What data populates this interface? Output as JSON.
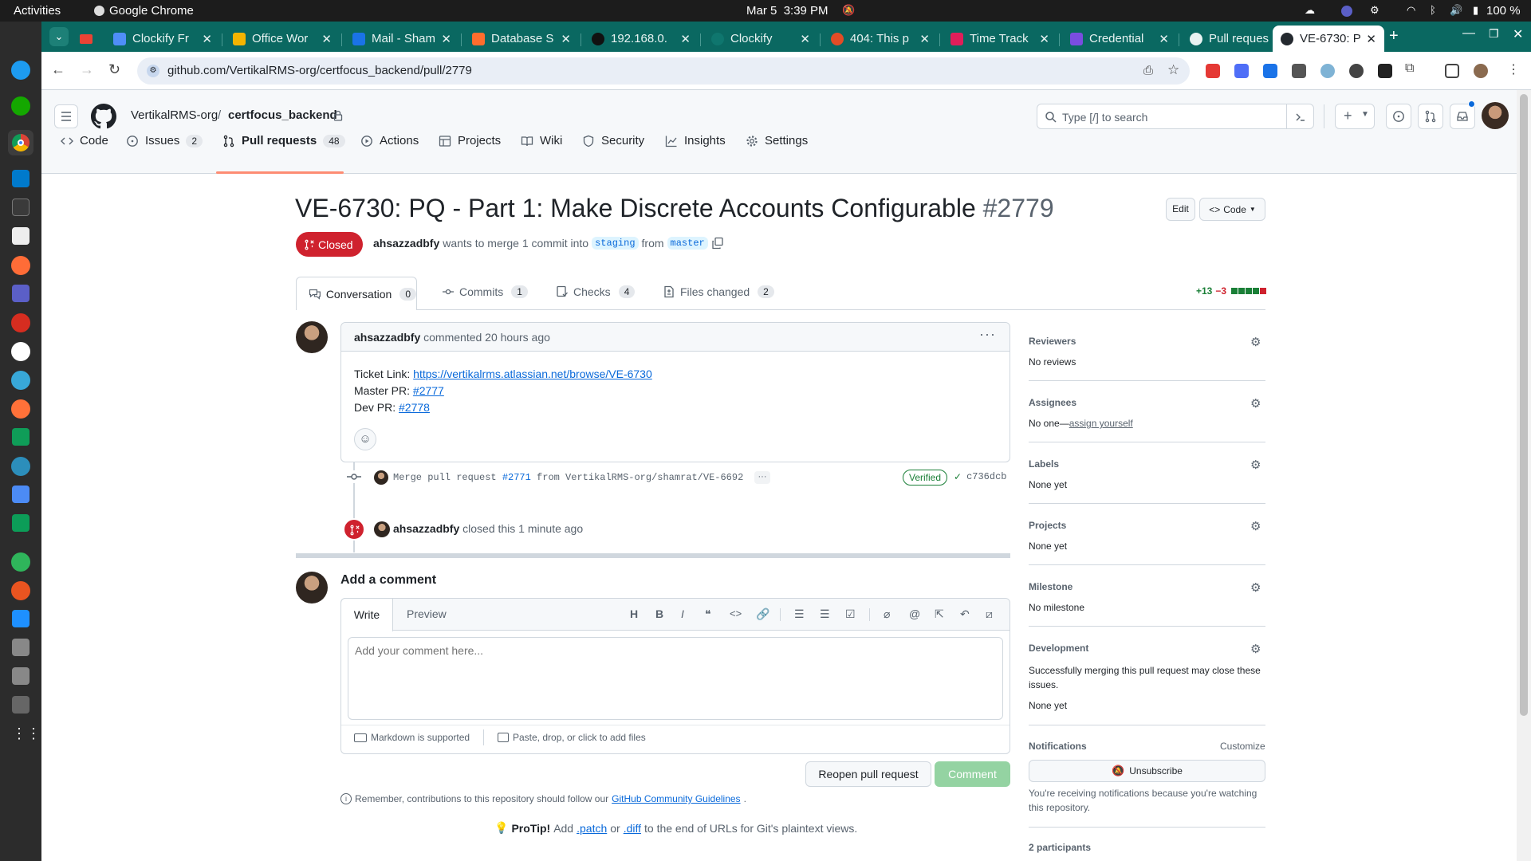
{
  "os": {
    "activities": "Activities",
    "app": "Google Chrome",
    "date": "Mar 5",
    "time": "3:39 PM",
    "battery": "100 %"
  },
  "tabs": [
    {
      "label": "Clockify Fr",
      "color": "#4f8ef7"
    },
    {
      "label": "Office Wor",
      "color": "#f4b400"
    },
    {
      "label": "Mail - Sham",
      "color": "#1a73e8"
    },
    {
      "label": "Database S",
      "color": "#ff6d2d"
    },
    {
      "label": "192.168.0.",
      "color": "#111111"
    },
    {
      "label": "Clockify",
      "color": "#0a6861"
    },
    {
      "label": "404: This p",
      "color": "#e34c26"
    },
    {
      "label": "Time Track",
      "color": "#e01e5a"
    },
    {
      "label": "Credential",
      "color": "#7a4de0"
    },
    {
      "label": "Pull reques",
      "color": "#24292f"
    },
    {
      "label": "VE-6730: P",
      "color": "#24292f"
    }
  ],
  "url": "github.com/VertikalRMS-org/certfocus_backend/pull/2779",
  "repo": {
    "owner": "VertikalRMS-org",
    "sep": "/",
    "name": "certfocus_backend",
    "search_placeholder": "Type [/] to search"
  },
  "nav": {
    "code": "Code",
    "issues": "Issues",
    "issues_count": "2",
    "prs": "Pull requests",
    "prs_count": "48",
    "actions": "Actions",
    "projects": "Projects",
    "wiki": "Wiki",
    "security": "Security",
    "insights": "Insights",
    "settings": "Settings"
  },
  "pr": {
    "title": "VE-6730: PQ - Part 1: Make Discrete Accounts Configurable",
    "number": "#2779",
    "edit": "Edit",
    "code": "Code",
    "state": "Closed",
    "author": "ahsazzadbfy",
    "merge_text_1": "wants to merge 1 commit into",
    "base": "staging",
    "from": "from",
    "head": "master"
  },
  "prtabs": {
    "conversation": "Conversation",
    "conversation_count": "0",
    "commits": "Commits",
    "commits_count": "1",
    "checks": "Checks",
    "checks_count": "4",
    "files": "Files changed",
    "files_count": "2",
    "additions": "+13",
    "deletions": "−3"
  },
  "comment": {
    "author": "ahsazzadbfy",
    "meta": "commented 20 hours ago",
    "ticket_label": "Ticket Link:",
    "ticket_url": "https://vertikalrms.atlassian.net/browse/VE-6730",
    "master_label": "Master PR:",
    "master_pr": "#2777",
    "dev_label": "Dev PR:",
    "dev_pr": "#2778"
  },
  "commit_event": {
    "text_a": "Merge pull request",
    "pr": "#2771",
    "text_b": "from VertikalRMS-org/shamrat/VE-6692",
    "verified": "Verified",
    "sha": "c736dcb"
  },
  "closed_event": {
    "author": "ahsazzadbfy",
    "text": "closed this 1 minute ago"
  },
  "add_comment": {
    "title": "Add a comment",
    "write": "Write",
    "preview": "Preview",
    "placeholder": "Add your comment here...",
    "markdown": "Markdown is supported",
    "attach": "Paste, drop, or click to add files",
    "reopen": "Reopen pull request",
    "comment": "Comment"
  },
  "footer": {
    "remember": "Remember, contributions to this repository should follow our",
    "guidelines": "GitHub Community Guidelines",
    "period": ".",
    "protip_label": "ProTip!",
    "protip_a": "Add",
    "patch": ".patch",
    "or": "or",
    "diff": ".diff",
    "protip_b": "to the end of URLs for Git's plaintext views."
  },
  "sidebar": {
    "reviewers": "Reviewers",
    "reviewers_val": "No reviews",
    "assignees": "Assignees",
    "assignees_val": "No one—",
    "assign_yourself": "assign yourself",
    "labels": "Labels",
    "labels_val": "None yet",
    "projects": "Projects",
    "projects_val": "None yet",
    "milestone": "Milestone",
    "milestone_val": "No milestone",
    "development": "Development",
    "development_desc": "Successfully merging this pull request may close these issues.",
    "development_val": "None yet",
    "notifications": "Notifications",
    "customize": "Customize",
    "unsubscribe": "Unsubscribe",
    "notif_desc": "You're receiving notifications because you're watching this repository.",
    "participants": "2 participants"
  },
  "colors": {
    "accent": "#0969da",
    "closed": "#cf222e",
    "teal": "#0a6861",
    "green": "#1a7f37"
  }
}
